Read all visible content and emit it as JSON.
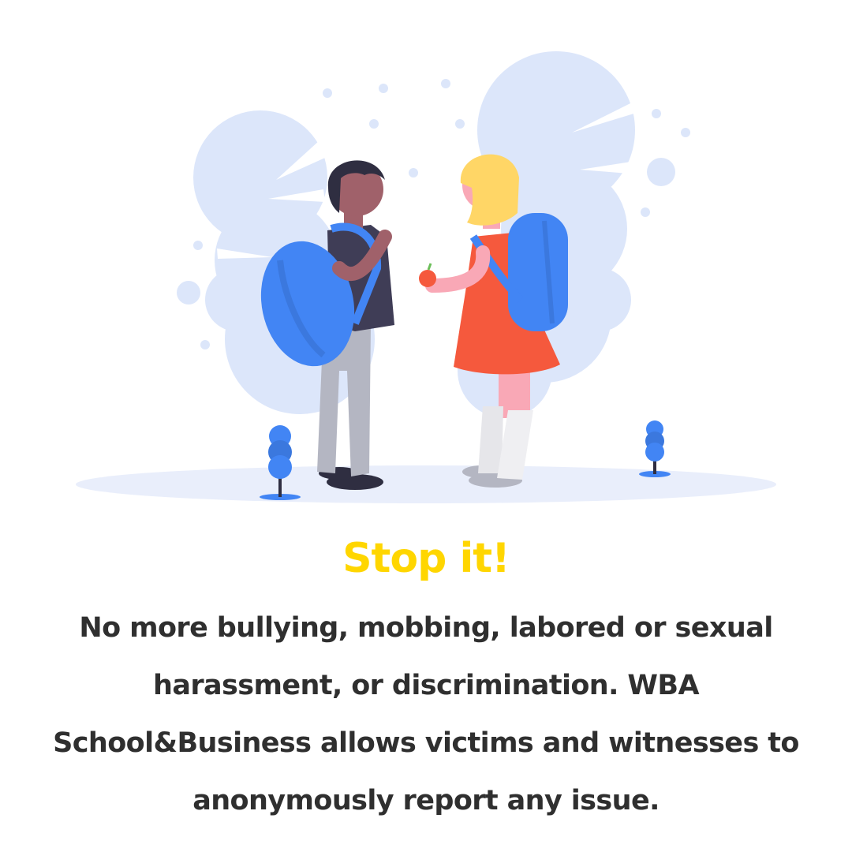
{
  "hero": {
    "illustration_icon": "two-students-with-backpacks-illustration"
  },
  "headline": "Stop it!",
  "description": "No more bullying, mobbing, labored or sexual harassment, or discrimination. WBA School&Business allows victims and witnesses to anonymously report any issue.",
  "colors": {
    "headline": "#FFD600",
    "body_text": "#2F2F2F",
    "cloud": "#DCE6FA",
    "ground": "#E9EEFB",
    "backpack": "#4285F4",
    "dress": "#F5593D",
    "hair_blonde": "#FFD666",
    "hair_dark": "#2F2E41",
    "skin_dark": "#A0616A",
    "skin_light": "#F9A8B6",
    "pants": "#B4B6C2"
  }
}
